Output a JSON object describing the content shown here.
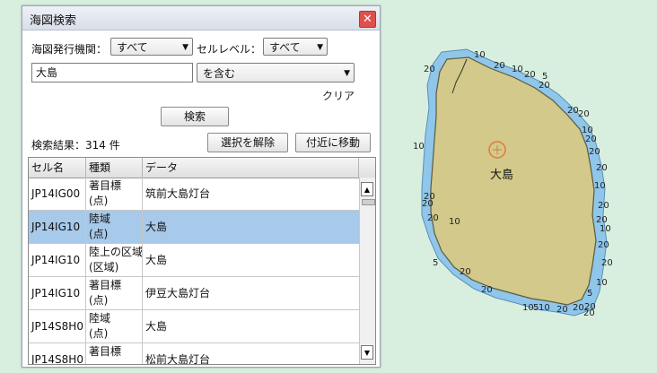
{
  "window": {
    "title": "海図検索"
  },
  "filters": {
    "issuer_label": "海図発行機関：",
    "issuer_value": "すべて",
    "cell_level_label": "セルレベル：",
    "cell_level_value": "すべて",
    "keyword_value": "大島",
    "match_mode_value": "を含む",
    "clear_label": "クリア"
  },
  "search_button_label": "検索",
  "results": {
    "summary": "検索結果：314 件",
    "deselect_label": "選択を解除",
    "move_near_label": "付近に移動",
    "columns": [
      "セル名",
      "種類",
      "データ"
    ],
    "rows": [
      {
        "cell": "JP14IG00",
        "type_line1": "著目標",
        "type_line2": "(点)",
        "data": "筑前大島灯台",
        "selected": false
      },
      {
        "cell": "JP14IG10",
        "type_line1": "陸域",
        "type_line2": "(点)",
        "data": "大島",
        "selected": true
      },
      {
        "cell": "JP14IG10",
        "type_line1": "陸上の区域",
        "type_line2": "(区域)",
        "data": "大島",
        "selected": false
      },
      {
        "cell": "JP14IG10",
        "type_line1": "著目標",
        "type_line2": "(点)",
        "data": "伊豆大島灯台",
        "selected": false
      },
      {
        "cell": "JP14S8H0",
        "type_line1": "陸域",
        "type_line2": "(点)",
        "data": "大島",
        "selected": false
      },
      {
        "cell": "JP14S8H0",
        "type_line1": "著目標",
        "type_line2": "",
        "data": "松前大島灯台",
        "selected": false
      }
    ]
  },
  "map": {
    "island_label": "大島",
    "land_color": "#d2c98a",
    "shallow_color": "#8fc6ea",
    "water_color": "#d8efe0",
    "depth_labels": [
      "10",
      "20",
      "10",
      "20",
      "20",
      "5",
      "20",
      "20",
      "10",
      "20",
      "20",
      "20",
      "10",
      "20",
      "20",
      "10",
      "20",
      "20",
      "10",
      "20",
      "5",
      "20",
      "20",
      "10",
      "5",
      "10",
      "20",
      "20",
      "20",
      "10",
      "20",
      "5",
      "20",
      "10",
      "20",
      "20"
    ]
  }
}
